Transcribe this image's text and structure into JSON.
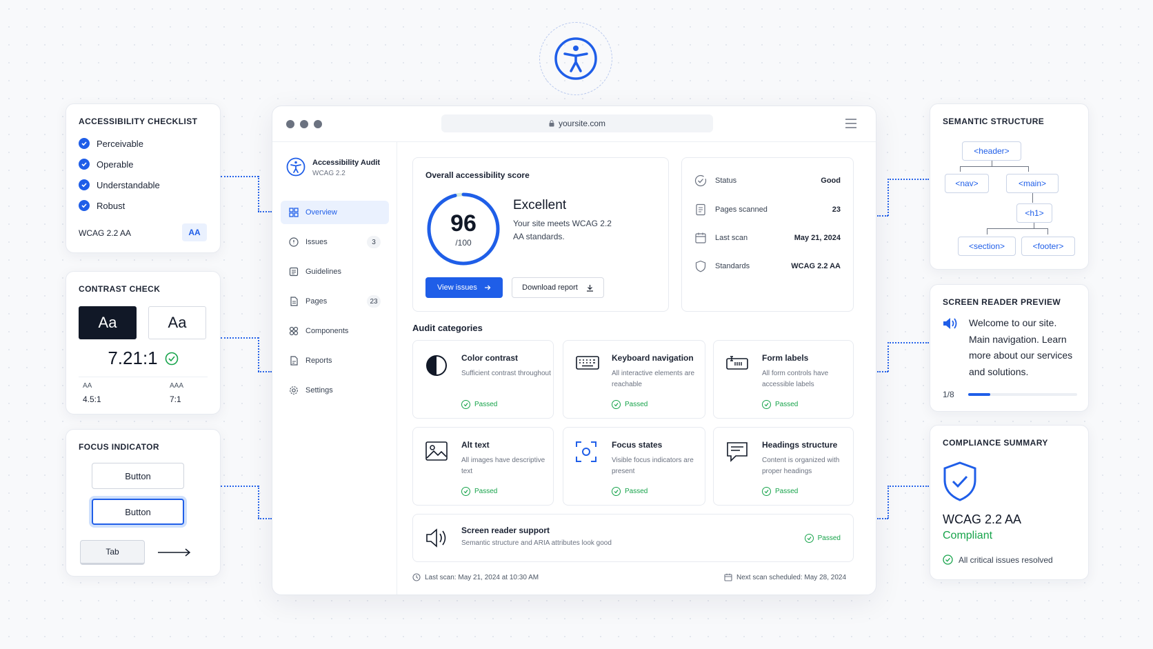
{
  "browser": {
    "url": "yoursite.com"
  },
  "app": {
    "name": "Accessibility Audit",
    "subtitle": "WCAG 2.2"
  },
  "nav": [
    {
      "label": "Overview",
      "icon": "grid-icon",
      "active": true,
      "count": ""
    },
    {
      "label": "Issues",
      "icon": "alert-icon",
      "active": false,
      "count": "3"
    },
    {
      "label": "Guidelines",
      "icon": "list-icon",
      "active": false,
      "count": ""
    },
    {
      "label": "Pages",
      "icon": "page-icon",
      "active": false,
      "count": "23"
    },
    {
      "label": "Components",
      "icon": "components-icon",
      "active": false,
      "count": ""
    },
    {
      "label": "Reports",
      "icon": "report-icon",
      "active": false,
      "count": ""
    },
    {
      "label": "Settings",
      "icon": "gear-icon",
      "active": false,
      "count": ""
    }
  ],
  "score": {
    "title": "Overall accessibility score",
    "value": "96",
    "max": "/100",
    "fraction": 0.96,
    "rating": "Excellent",
    "description": "Your site meets WCAG 2.2 AA standards.",
    "view_issues": "View issues",
    "download_report": "Download report"
  },
  "stats": [
    {
      "label": "Status",
      "value": "Good",
      "icon": "check-circle-icon"
    },
    {
      "label": "Pages scanned",
      "value": "23",
      "icon": "document-icon"
    },
    {
      "label": "Last scan",
      "value": "May 21, 2024",
      "icon": "calendar-icon"
    },
    {
      "label": "Standards",
      "value": "WCAG 2.2 AA",
      "icon": "shield-icon"
    }
  ],
  "audit": {
    "title": "Audit categories",
    "categories": [
      {
        "title": "Color contrast",
        "desc": "Sufficient contrast throughout",
        "status": "Passed",
        "icon": "contrast-icon"
      },
      {
        "title": "Keyboard navigation",
        "desc": "All interactive elements are reachable",
        "status": "Passed",
        "icon": "keyboard-icon"
      },
      {
        "title": "Form labels",
        "desc": "All form controls have accessible labels",
        "status": "Passed",
        "icon": "form-icon"
      },
      {
        "title": "Alt text",
        "desc": "All images have descriptive text",
        "status": "Passed",
        "icon": "image-icon"
      },
      {
        "title": "Focus states",
        "desc": "Visible focus indicators are present",
        "status": "Passed",
        "icon": "focus-icon"
      },
      {
        "title": "Headings structure",
        "desc": "Content is organized with proper headings",
        "status": "Passed",
        "icon": "chat-icon"
      }
    ],
    "screen_reader": {
      "title": "Screen reader support",
      "desc": "Semantic structure and ARIA attributes look good",
      "status": "Passed"
    }
  },
  "footer": {
    "last_scan": "Last scan: May 21, 2024 at 10:30 AM",
    "next_scan": "Next scan scheduled: May 28, 2024"
  },
  "checklist": {
    "title": "ACCESSIBILITY CHECKLIST",
    "items": [
      "Perceivable",
      "Operable",
      "Understandable",
      "Robust"
    ],
    "level_label": "WCAG 2.2 AA",
    "level_badge": "AA"
  },
  "contrast": {
    "title": "CONTRAST CHECK",
    "sample": "Aa",
    "ratio": "7.21:1",
    "aa_label": "AA",
    "aa_value": "4.5:1",
    "aaa_label": "AAA",
    "aaa_value": "7:1"
  },
  "focus": {
    "title": "FOCUS INDICATOR",
    "button1": "Button",
    "button2": "Button",
    "tab": "Tab"
  },
  "semantic": {
    "title": "SEMANTIC STRUCTURE",
    "header": "<header>",
    "nav": "<nav>",
    "main": "<main>",
    "h1": "<h1>",
    "section": "<section>",
    "footer": "<footer>"
  },
  "screen_reader": {
    "title": "SCREEN READER PREVIEW",
    "text": "Welcome to our site. Main navigation. Learn more about our services and solutions.",
    "progress_label": "1/8",
    "progress": 0.125
  },
  "compliance": {
    "title": "COMPLIANCE SUMMARY",
    "standard": "WCAG 2.2 AA",
    "status": "Compliant",
    "note": "All critical issues resolved"
  },
  "colors": {
    "accent": "#1f5ee8",
    "success": "#16a34a",
    "dark": "#111827"
  }
}
